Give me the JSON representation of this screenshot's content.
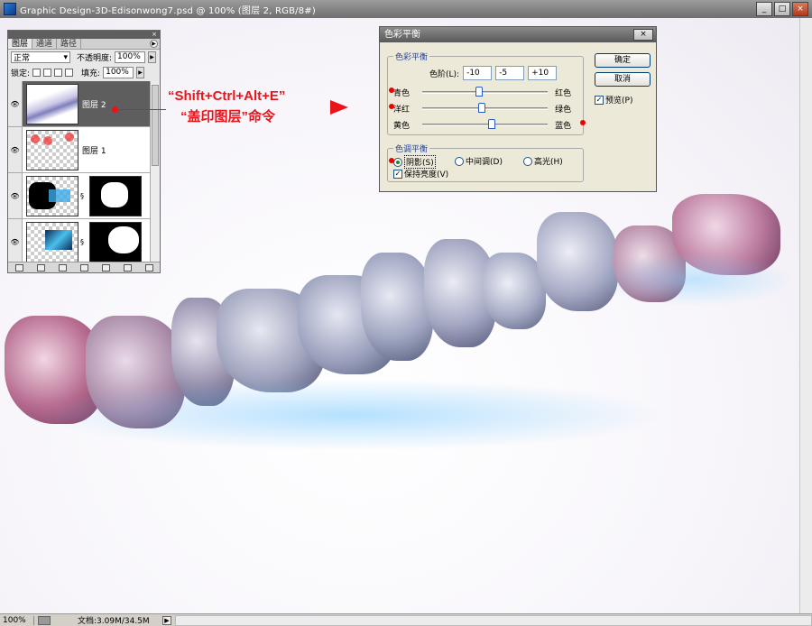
{
  "window": {
    "title": "Graphic Design-3D-Edisonwong7.psd @ 100% (图层 2, RGB/8#)",
    "buttons": {
      "minimize": "_",
      "maximize": "□",
      "close": "×"
    }
  },
  "status": {
    "zoom": "100%",
    "document": "文档:3.09M/34.5M",
    "arrow": "▶"
  },
  "layers_panel": {
    "tabs": [
      "图层",
      "通道",
      "路径"
    ],
    "blend_mode": "正常",
    "opacity_label": "不透明度:",
    "opacity_value": "100%",
    "lock_label": "锁定:",
    "fill_label": "填充:",
    "fill_value": "100%",
    "layers": [
      {
        "name": "图层 2",
        "selected": true
      },
      {
        "name": "图层 1",
        "selected": false
      },
      {
        "name": "",
        "selected": false
      },
      {
        "name": "",
        "selected": false
      }
    ]
  },
  "annotation": {
    "line1": "“Shift+Ctrl+Alt+E”",
    "line2": "“盖印图层”命令"
  },
  "dialog": {
    "title": "色彩平衡",
    "group_color": "色彩平衡",
    "levels_label": "色阶(L):",
    "levels": [
      "-10",
      "-5",
      "+10"
    ],
    "sliders": [
      {
        "left": "青色",
        "right": "红色",
        "value": -10
      },
      {
        "left": "洋红",
        "right": "绿色",
        "value": -5
      },
      {
        "left": "黄色",
        "right": "蓝色",
        "value": 10
      }
    ],
    "group_tone": "色调平衡",
    "tones": [
      "阴影(S)",
      "中间调(D)",
      "高光(H)"
    ],
    "selected_tone": "阴影(S)",
    "preserve_label": "保持亮度(V)",
    "preserve_checked": true,
    "ok_label": "确定",
    "cancel_label": "取消",
    "preview_label": "预览(P)",
    "preview_checked": true,
    "close_label": "×"
  }
}
